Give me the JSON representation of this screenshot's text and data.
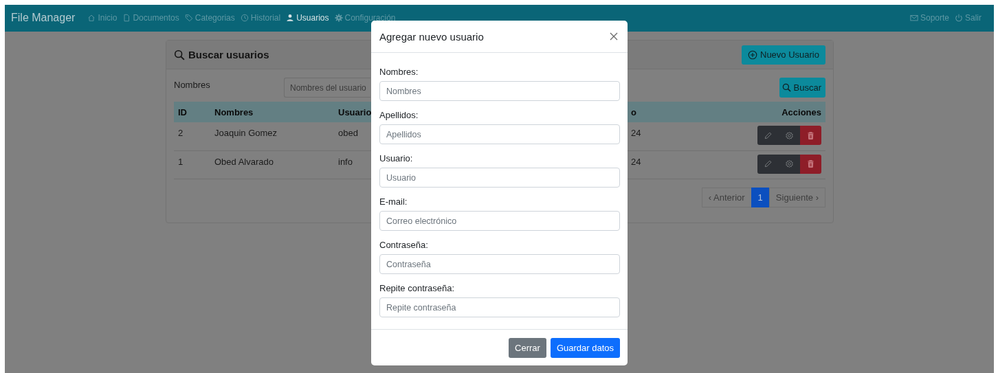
{
  "navbar": {
    "brand": "File Manager",
    "links": [
      {
        "label": "Inicio",
        "selected": false
      },
      {
        "label": "Documentos",
        "selected": false
      },
      {
        "label": "Categorias",
        "selected": false
      },
      {
        "label": "Historial",
        "selected": false
      },
      {
        "label": "Usuarios",
        "selected": true
      },
      {
        "label": "Configuración",
        "selected": false
      }
    ],
    "right_links": [
      "Soporte",
      "Salir"
    ]
  },
  "card": {
    "title": "Buscar usuarios",
    "new_button": "Nuevo Usuario",
    "filter": {
      "label": "Nombres",
      "placeholder": "Nombres del usuario",
      "button": "Buscar"
    },
    "table": {
      "columns": [
        "ID",
        "Nombres",
        "Usuario",
        "o",
        "Acciones"
      ],
      "rows": [
        [
          "2",
          "Joaquin Gomez",
          "obed",
          "24"
        ],
        [
          "1",
          "Obed Alvarado",
          "info",
          "24"
        ]
      ]
    },
    "pagination": {
      "previous": "‹ Anterior",
      "pages": [
        {
          "label": "1",
          "selected": true
        }
      ],
      "next": "Siguiente ›"
    }
  },
  "modal": {
    "title": "Agregar nuevo usuario",
    "fields": [
      {
        "label": "Nombres:",
        "placeholder": "Nombres"
      },
      {
        "label": "Apellidos:",
        "placeholder": "Apellidos"
      },
      {
        "label": "Usuario:",
        "placeholder": "Usuario"
      },
      {
        "label": "E-mail:",
        "placeholder": "Correo electrónico"
      },
      {
        "label": "Contraseña:",
        "placeholder": "Contraseña"
      },
      {
        "label": "Repite contraseña:",
        "placeholder": "Repite contraseña"
      }
    ],
    "buttons": [
      {
        "label": "Cerrar",
        "kind": "secondary"
      },
      {
        "label": "Guardar datos",
        "kind": "primary"
      }
    ]
  }
}
